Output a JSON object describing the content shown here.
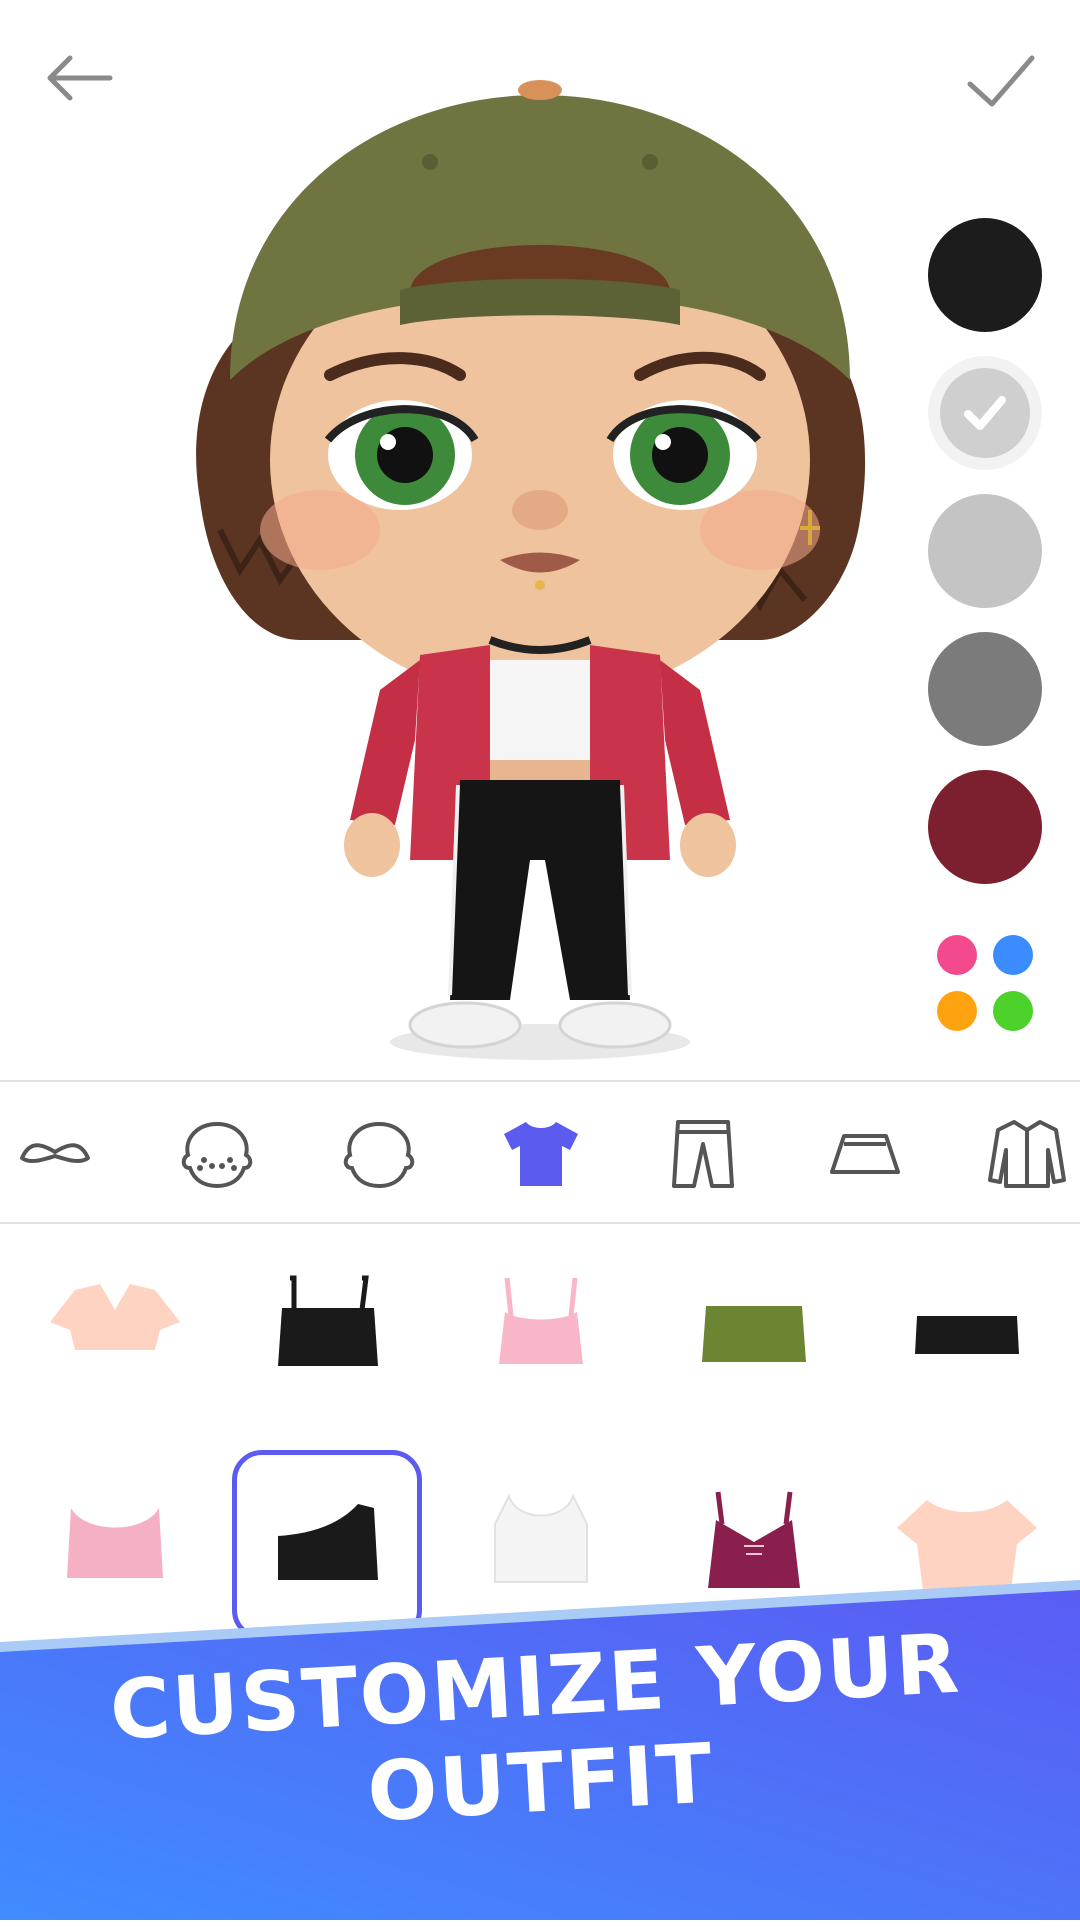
{
  "toolbar": {
    "back_icon": "arrow-left-icon",
    "confirm_icon": "checkmark-icon"
  },
  "colors": {
    "accent": "#5b5bf0",
    "banner_start": "#3f8cff",
    "banner_end": "#5a5cf3",
    "options": [
      "#1c1c1c",
      "#e0e0e0",
      "#c4c4c4",
      "#7b7b7b",
      "#7c1f2e"
    ],
    "selected_index": 1,
    "more_palette": [
      "#f24a8c",
      "#3a8cff",
      "#ffa310",
      "#4dd12b"
    ]
  },
  "categories": [
    {
      "icon": "mustache-icon",
      "selected": false
    },
    {
      "icon": "freckles-face-icon",
      "selected": false
    },
    {
      "icon": "face-shape-icon",
      "selected": false
    },
    {
      "icon": "tshirt-icon",
      "selected": true
    },
    {
      "icon": "pants-icon",
      "selected": false
    },
    {
      "icon": "skirt-icon",
      "selected": false
    },
    {
      "icon": "jacket-icon",
      "selected": false
    }
  ],
  "items": [
    {
      "name": "peach-vneck-crop-top",
      "color": "#ffd3c2"
    },
    {
      "name": "black-cami-crop-top",
      "color": "#1a1a1a"
    },
    {
      "name": "pink-cami-crop-top",
      "color": "#f8b6c8"
    },
    {
      "name": "green-tube-top",
      "color": "#6b8532"
    },
    {
      "name": "black-bandeau-top",
      "color": "#1a1a1a"
    },
    {
      "name": "pink-bralette-top",
      "color": "#f6b0c4"
    },
    {
      "name": "black-one-shoulder-top",
      "color": "#1a1a1a",
      "selected": true
    },
    {
      "name": "white-tank-crop-top",
      "color": "#f4f4f4"
    },
    {
      "name": "plum-lace-up-top",
      "color": "#8a1f4e"
    },
    {
      "name": "peach-tshirt-crop-top",
      "color": "#ffd3c2"
    }
  ],
  "banner": {
    "line1": "CUSTOMIZE YOUR",
    "line2": "OUTFIT"
  }
}
